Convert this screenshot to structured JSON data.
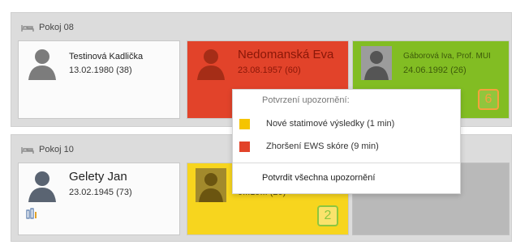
{
  "rooms": [
    {
      "name": "Pokoj 08",
      "patients": [
        {
          "name": "Testinová Kadlička",
          "dob": "13.02.1980 (38)",
          "color": "#fbfbfb"
        },
        {
          "name": "Nedomanská Eva",
          "dob": "23.08.1957 (60)",
          "color": "#e2432a"
        },
        {
          "name": "Gáborová Iva, Prof. MUI",
          "dob": "24.06.1992 (26)",
          "color": "#82bd23",
          "alert_count": "6"
        }
      ]
    },
    {
      "name": "Pokoj 10",
      "patients": [
        {
          "name": "Gelety Jan",
          "dob": "23.02.1945 (73)",
          "color": "#fbfbfb"
        },
        {
          "name": "K",
          "dob": "0...19... (20)",
          "color": "#f7d51e",
          "alert_count": "2"
        },
        {
          "name": "",
          "dob": "",
          "color": "#b9b9b9"
        }
      ]
    }
  ],
  "popup": {
    "title": "Potvrzení upozornění:",
    "items": [
      {
        "label": "Nové statimové výsledky (1 min)",
        "color": "#f5c400"
      },
      {
        "label": "Zhoršení EWS skóre (9 min)",
        "color": "#e2432a"
      }
    ],
    "confirm_all": "Potvrdit všechna upozornění"
  }
}
